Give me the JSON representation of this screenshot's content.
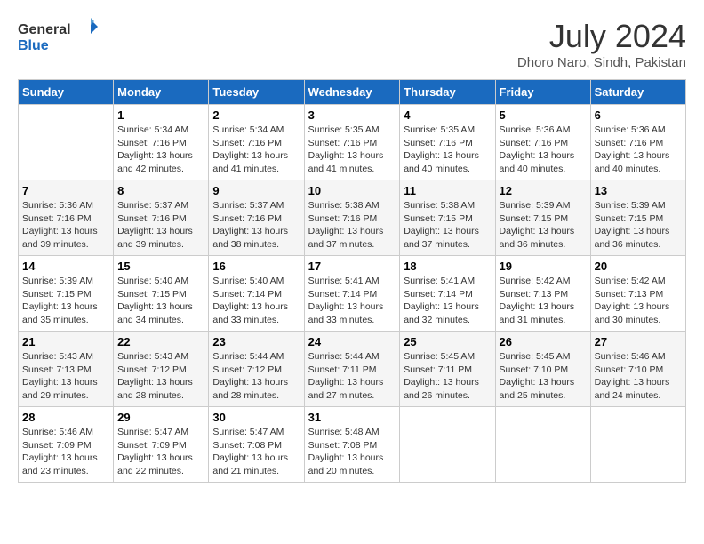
{
  "header": {
    "logo_line1": "General",
    "logo_line2": "Blue",
    "month_year": "July 2024",
    "location": "Dhoro Naro, Sindh, Pakistan"
  },
  "days_of_week": [
    "Sunday",
    "Monday",
    "Tuesday",
    "Wednesday",
    "Thursday",
    "Friday",
    "Saturday"
  ],
  "weeks": [
    [
      {
        "day": "",
        "text": ""
      },
      {
        "day": "1",
        "text": "Sunrise: 5:34 AM\nSunset: 7:16 PM\nDaylight: 13 hours\nand 42 minutes."
      },
      {
        "day": "2",
        "text": "Sunrise: 5:34 AM\nSunset: 7:16 PM\nDaylight: 13 hours\nand 41 minutes."
      },
      {
        "day": "3",
        "text": "Sunrise: 5:35 AM\nSunset: 7:16 PM\nDaylight: 13 hours\nand 41 minutes."
      },
      {
        "day": "4",
        "text": "Sunrise: 5:35 AM\nSunset: 7:16 PM\nDaylight: 13 hours\nand 40 minutes."
      },
      {
        "day": "5",
        "text": "Sunrise: 5:36 AM\nSunset: 7:16 PM\nDaylight: 13 hours\nand 40 minutes."
      },
      {
        "day": "6",
        "text": "Sunrise: 5:36 AM\nSunset: 7:16 PM\nDaylight: 13 hours\nand 40 minutes."
      }
    ],
    [
      {
        "day": "7",
        "text": "Sunrise: 5:36 AM\nSunset: 7:16 PM\nDaylight: 13 hours\nand 39 minutes."
      },
      {
        "day": "8",
        "text": "Sunrise: 5:37 AM\nSunset: 7:16 PM\nDaylight: 13 hours\nand 39 minutes."
      },
      {
        "day": "9",
        "text": "Sunrise: 5:37 AM\nSunset: 7:16 PM\nDaylight: 13 hours\nand 38 minutes."
      },
      {
        "day": "10",
        "text": "Sunrise: 5:38 AM\nSunset: 7:16 PM\nDaylight: 13 hours\nand 37 minutes."
      },
      {
        "day": "11",
        "text": "Sunrise: 5:38 AM\nSunset: 7:15 PM\nDaylight: 13 hours\nand 37 minutes."
      },
      {
        "day": "12",
        "text": "Sunrise: 5:39 AM\nSunset: 7:15 PM\nDaylight: 13 hours\nand 36 minutes."
      },
      {
        "day": "13",
        "text": "Sunrise: 5:39 AM\nSunset: 7:15 PM\nDaylight: 13 hours\nand 36 minutes."
      }
    ],
    [
      {
        "day": "14",
        "text": "Sunrise: 5:39 AM\nSunset: 7:15 PM\nDaylight: 13 hours\nand 35 minutes."
      },
      {
        "day": "15",
        "text": "Sunrise: 5:40 AM\nSunset: 7:15 PM\nDaylight: 13 hours\nand 34 minutes."
      },
      {
        "day": "16",
        "text": "Sunrise: 5:40 AM\nSunset: 7:14 PM\nDaylight: 13 hours\nand 33 minutes."
      },
      {
        "day": "17",
        "text": "Sunrise: 5:41 AM\nSunset: 7:14 PM\nDaylight: 13 hours\nand 33 minutes."
      },
      {
        "day": "18",
        "text": "Sunrise: 5:41 AM\nSunset: 7:14 PM\nDaylight: 13 hours\nand 32 minutes."
      },
      {
        "day": "19",
        "text": "Sunrise: 5:42 AM\nSunset: 7:13 PM\nDaylight: 13 hours\nand 31 minutes."
      },
      {
        "day": "20",
        "text": "Sunrise: 5:42 AM\nSunset: 7:13 PM\nDaylight: 13 hours\nand 30 minutes."
      }
    ],
    [
      {
        "day": "21",
        "text": "Sunrise: 5:43 AM\nSunset: 7:13 PM\nDaylight: 13 hours\nand 29 minutes."
      },
      {
        "day": "22",
        "text": "Sunrise: 5:43 AM\nSunset: 7:12 PM\nDaylight: 13 hours\nand 28 minutes."
      },
      {
        "day": "23",
        "text": "Sunrise: 5:44 AM\nSunset: 7:12 PM\nDaylight: 13 hours\nand 28 minutes."
      },
      {
        "day": "24",
        "text": "Sunrise: 5:44 AM\nSunset: 7:11 PM\nDaylight: 13 hours\nand 27 minutes."
      },
      {
        "day": "25",
        "text": "Sunrise: 5:45 AM\nSunset: 7:11 PM\nDaylight: 13 hours\nand 26 minutes."
      },
      {
        "day": "26",
        "text": "Sunrise: 5:45 AM\nSunset: 7:10 PM\nDaylight: 13 hours\nand 25 minutes."
      },
      {
        "day": "27",
        "text": "Sunrise: 5:46 AM\nSunset: 7:10 PM\nDaylight: 13 hours\nand 24 minutes."
      }
    ],
    [
      {
        "day": "28",
        "text": "Sunrise: 5:46 AM\nSunset: 7:09 PM\nDaylight: 13 hours\nand 23 minutes."
      },
      {
        "day": "29",
        "text": "Sunrise: 5:47 AM\nSunset: 7:09 PM\nDaylight: 13 hours\nand 22 minutes."
      },
      {
        "day": "30",
        "text": "Sunrise: 5:47 AM\nSunset: 7:08 PM\nDaylight: 13 hours\nand 21 minutes."
      },
      {
        "day": "31",
        "text": "Sunrise: 5:48 AM\nSunset: 7:08 PM\nDaylight: 13 hours\nand 20 minutes."
      },
      {
        "day": "",
        "text": ""
      },
      {
        "day": "",
        "text": ""
      },
      {
        "day": "",
        "text": ""
      }
    ]
  ]
}
